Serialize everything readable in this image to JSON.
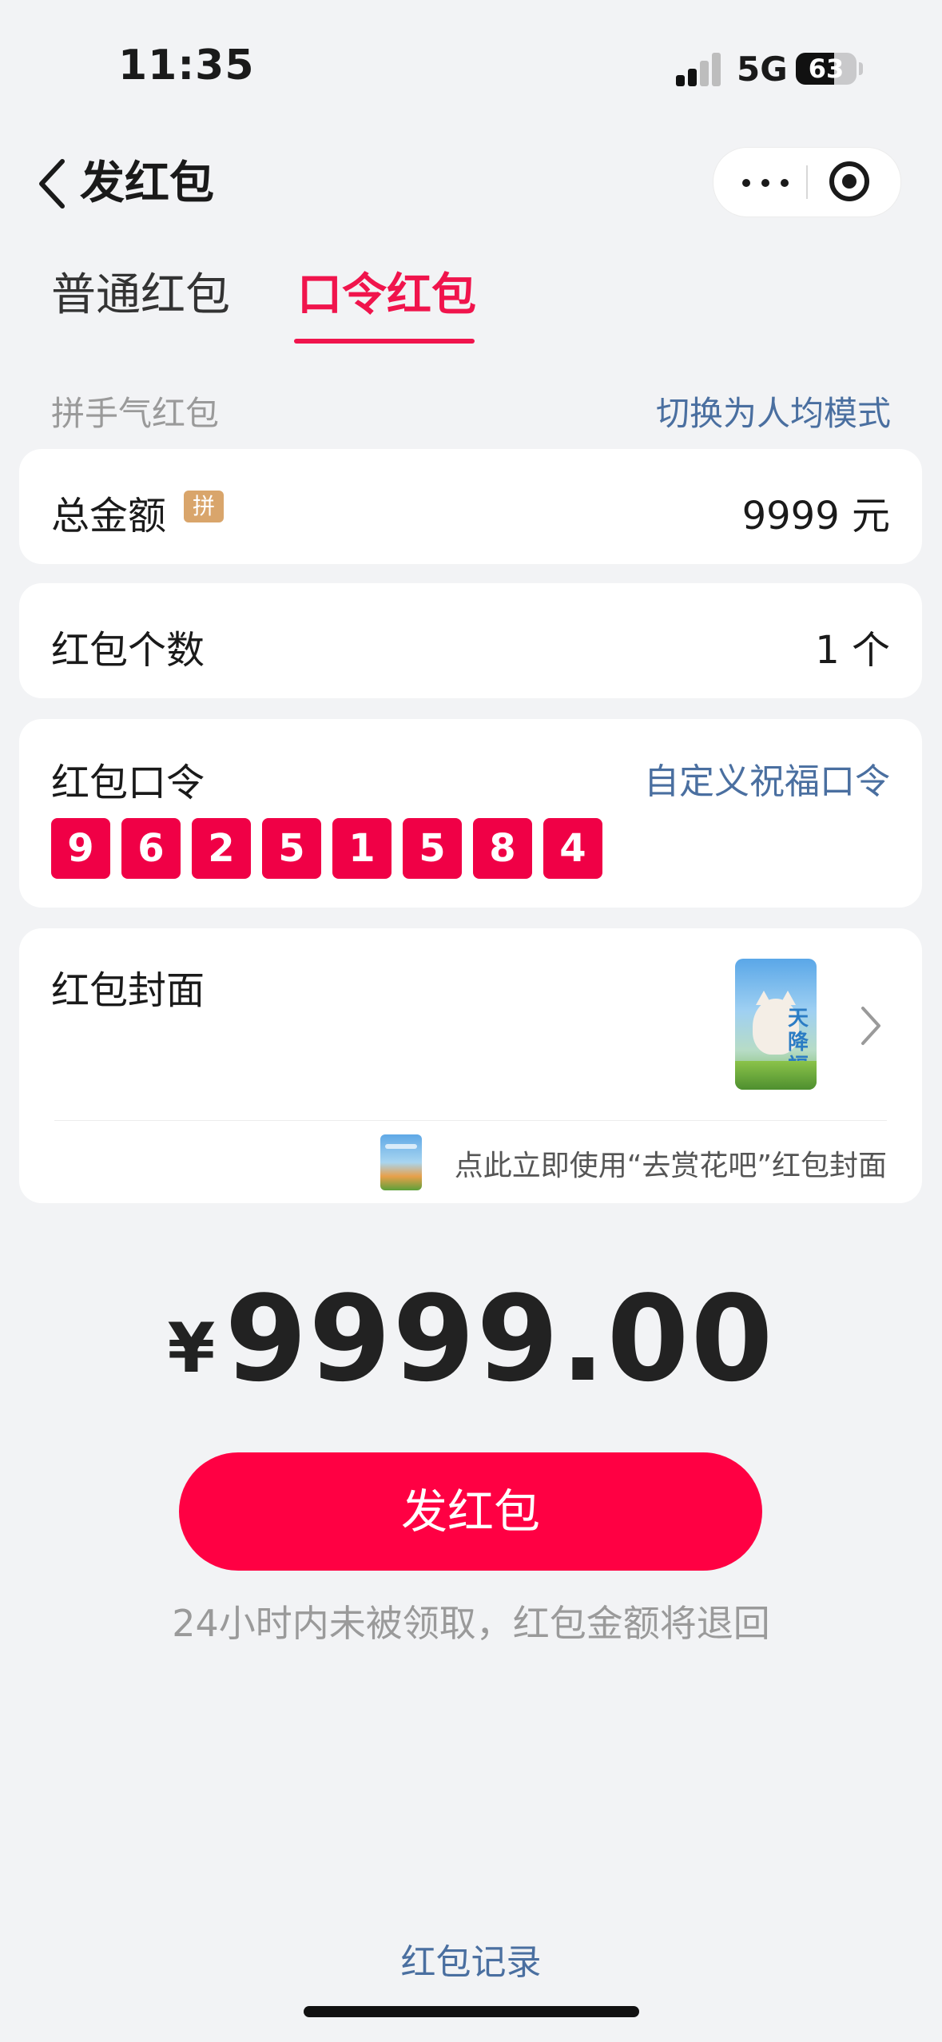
{
  "status_bar": {
    "time": "11:35",
    "network": "5G",
    "battery": "63",
    "battery_level": 0.63
  },
  "nav": {
    "title": "发红包",
    "icons": [
      "chevron-left-icon",
      "more-icon",
      "target-icon"
    ]
  },
  "tabs": [
    {
      "label": "普通红包",
      "active": false
    },
    {
      "label": "口令红包",
      "active": true
    }
  ],
  "mode": {
    "label": "拼手气红包",
    "switch_link": "切换为人均模式"
  },
  "amount_row": {
    "label": "总金额",
    "badge": "拼",
    "value": "9999 元"
  },
  "count_row": {
    "label": "红包个数",
    "value": "1 个"
  },
  "password_row": {
    "label": "红包口令",
    "custom_link": "自定义祝福口令",
    "digits": [
      "9",
      "6",
      "2",
      "5",
      "1",
      "5",
      "8",
      "4"
    ]
  },
  "cover_row": {
    "label": "红包封面",
    "thumb_text": "天降福",
    "quick_use_text": "点此立即使用“去赏花吧”红包封面"
  },
  "total": {
    "currency": "¥",
    "value": "9999.00"
  },
  "send_button": "发红包",
  "refund_note": "24小时内未被领取，红包金额将退回",
  "records_link": "红包记录",
  "colors": {
    "accent": "#f0144c",
    "button": "#ff0043",
    "link": "#4a6fa0",
    "background": "#f2f3f5"
  }
}
